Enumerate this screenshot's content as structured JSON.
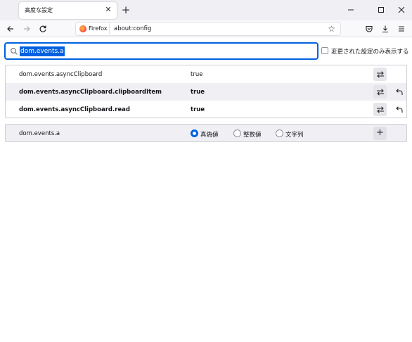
{
  "tab": {
    "title": "高度な設定"
  },
  "nav": {
    "identity_label": "Firefox",
    "url": "about:config"
  },
  "search": {
    "value": "dom.events.a",
    "show_modified_label": "変更された設定のみ表示する",
    "show_modified_checked": false
  },
  "prefs": [
    {
      "name": "dom.events.asyncClipboard",
      "value": "true",
      "modified": false
    },
    {
      "name": "dom.events.asyncClipboard.clipboardItem",
      "value": "true",
      "modified": true
    },
    {
      "name": "dom.events.asyncClipboard.read",
      "value": "true",
      "modified": true
    }
  ],
  "add_pref": {
    "name": "dom.events.a",
    "types": [
      {
        "label": "真偽値",
        "checked": true
      },
      {
        "label": "整数値",
        "checked": false
      },
      {
        "label": "文字列",
        "checked": false
      }
    ]
  },
  "colors": {
    "accent": "#0061e0",
    "row_alt": "#f0f0f4"
  }
}
